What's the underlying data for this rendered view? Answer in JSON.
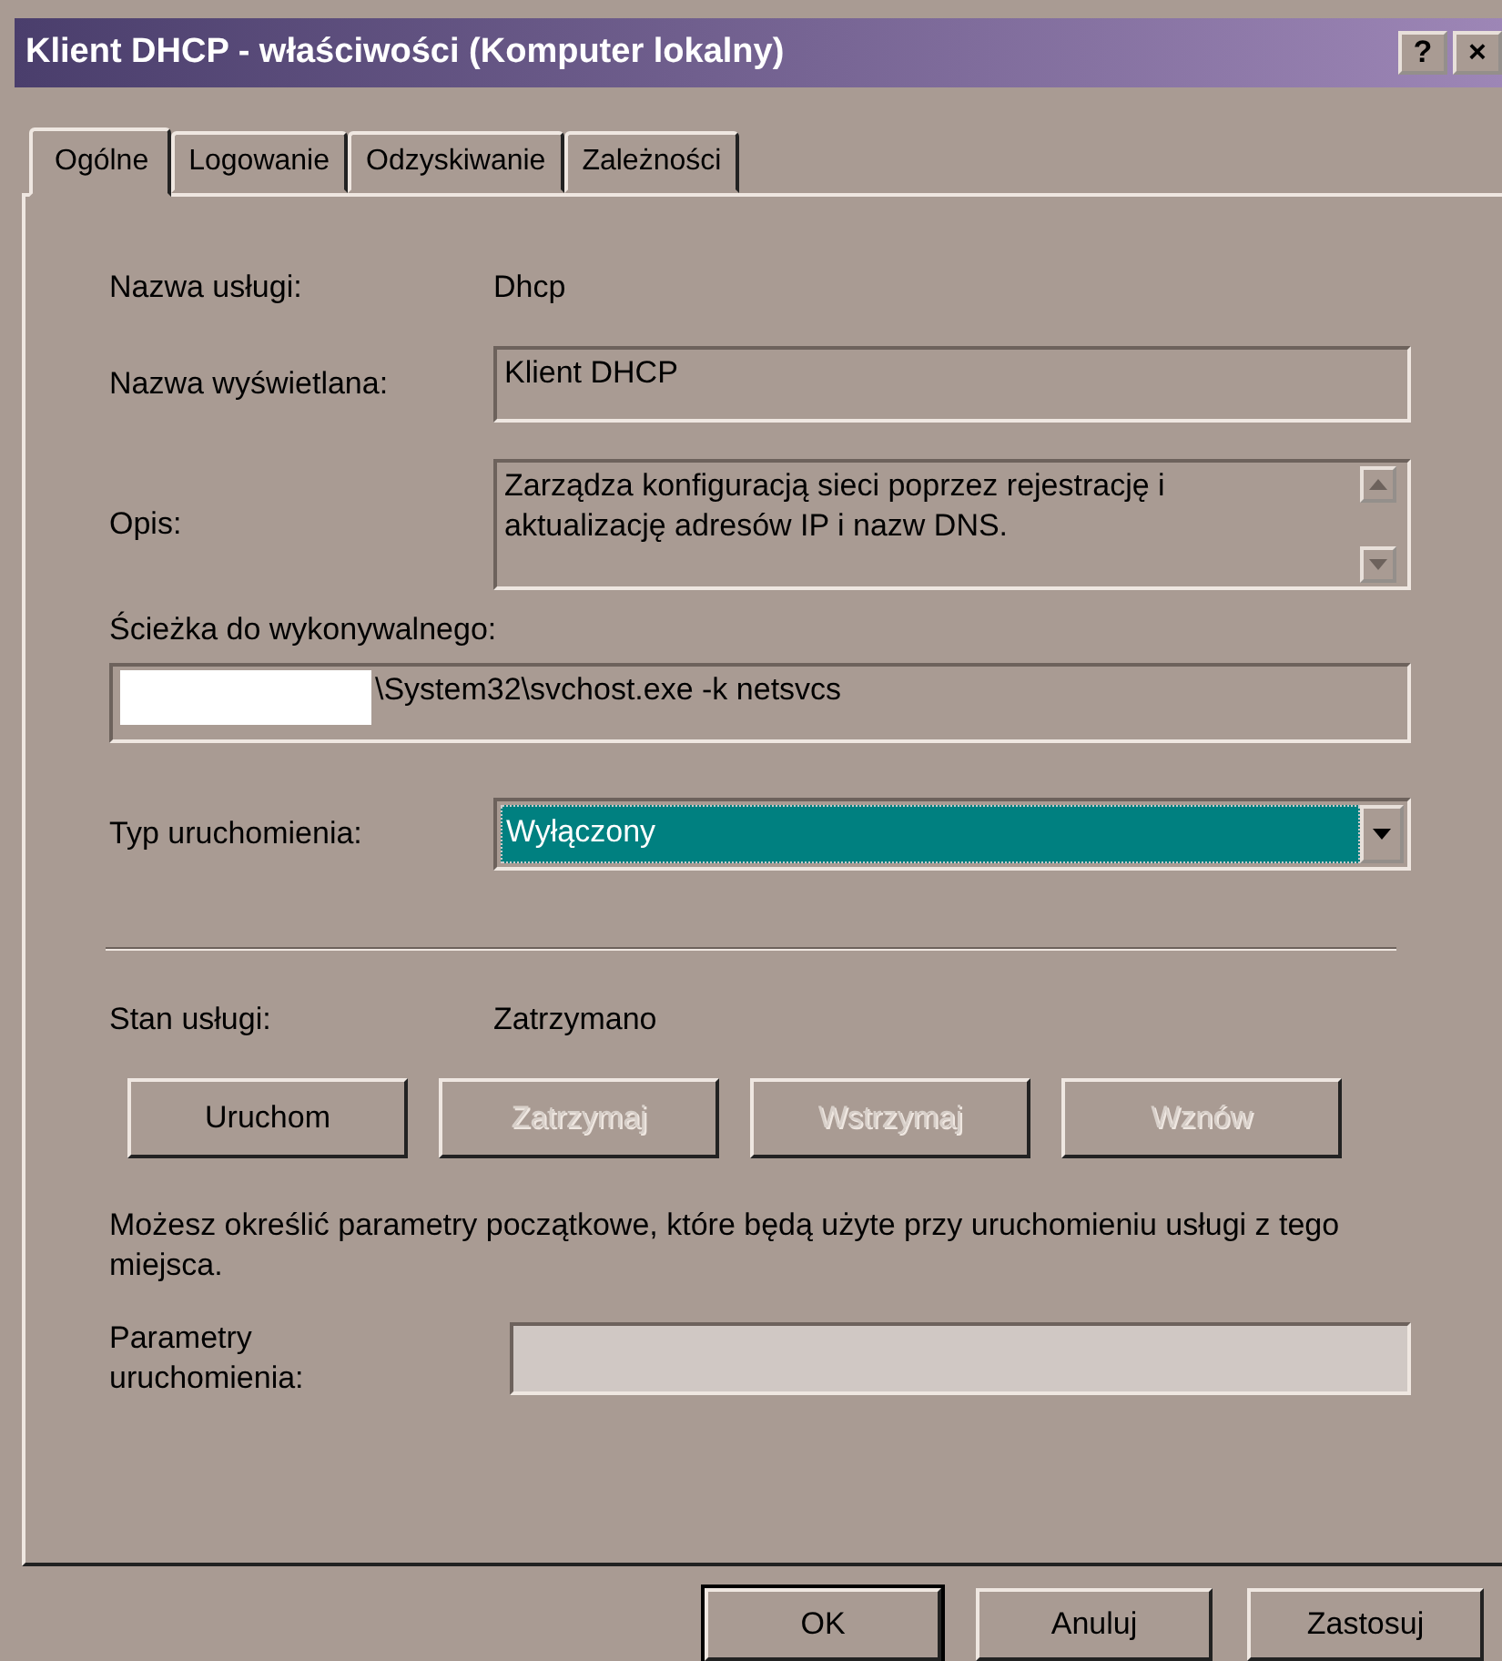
{
  "window": {
    "title": "Klient DHCP - właściwości (Komputer lokalny)",
    "title_buttons": [
      "?",
      "×"
    ]
  },
  "tabs": [
    {
      "label": "Ogólne",
      "selected": true
    },
    {
      "label": "Logowanie",
      "selected": false
    },
    {
      "label": "Odzyskiwanie",
      "selected": false
    },
    {
      "label": "Zależności",
      "selected": false
    }
  ],
  "general": {
    "service_name": {
      "label": "Nazwa usługi:",
      "value": "Dhcp"
    },
    "display_name": {
      "label": "Nazwa wyświetlana:",
      "value": "Klient DHCP"
    },
    "description": {
      "label": "Opis:",
      "value": "Zarządza konfiguracją sieci poprzez rejestrację i aktualizację adresów IP i nazw DNS."
    },
    "path": {
      "label": "Ścieżka do wykonywalnego:",
      "value": "\\System32\\svchost.exe -k netsvcs",
      "redacted": true
    },
    "startup_type": {
      "label": "Typ uruchomienia:",
      "value": "Wyłączony"
    },
    "status": {
      "label": "Stan usługi:",
      "value": "Zatrzymano"
    },
    "service_buttons": [
      {
        "label": "Uruchom",
        "disabled": false
      },
      {
        "label": "Zatrzymaj",
        "disabled": true
      },
      {
        "label": "Wstrzymaj",
        "disabled": true
      },
      {
        "label": "Wznów",
        "disabled": true
      }
    ],
    "hint": "Możesz określić parametry początkowe, które będą użyte przy uruchomieniu usługi z tego miejsca.",
    "start_params": {
      "label": "Parametry uruchomienia:"
    }
  },
  "buttons": [
    {
      "label": "OK",
      "default": true
    },
    {
      "label": "Anuluj",
      "default": false
    },
    {
      "label": "Zastosuj",
      "default": false
    }
  ]
}
